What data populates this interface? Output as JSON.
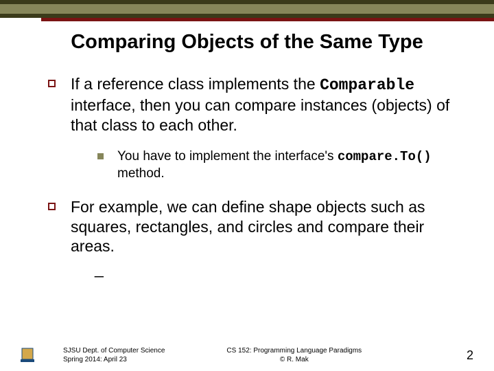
{
  "title": "Comparing Objects of the Same Type",
  "bullets": [
    {
      "pre": "If a reference class implements the ",
      "code": "Comparable",
      "post": " interface, then you can compare instances (objects) of that class to each other."
    },
    {
      "pre": "For example, we can define shape objects such as squares, rectangles, and circles and compare their areas.",
      "code": "",
      "post": ""
    }
  ],
  "subbullet": {
    "pre": "You have to implement the interface's ",
    "code": "compare.To()",
    "post": " method."
  },
  "dash": "_",
  "footer": {
    "left_line1": "SJSU Dept. of Computer Science",
    "left_line2": "Spring 2014: April 23",
    "center_line1": "CS 152: Programming Language Paradigms",
    "center_line2": "© R. Mak",
    "page": "2"
  }
}
